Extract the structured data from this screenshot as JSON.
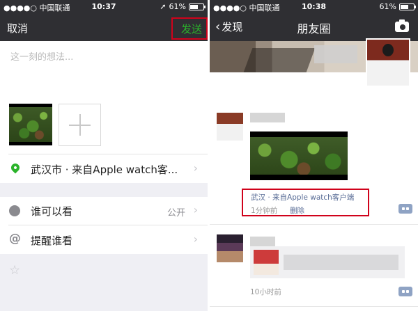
{
  "left": {
    "status": {
      "carrier": "●●●●○ 中国联通",
      "time": "10:37",
      "battery": "61%",
      "battery_level": 0.61
    },
    "nav": {
      "cancel": "取消",
      "send": "发送"
    },
    "compose": {
      "placeholder": "这一刻的想法..."
    },
    "location": {
      "label": "武汉市 · 来自Apple watch客..."
    },
    "visibility": {
      "label": "谁可以看",
      "value": "公开"
    },
    "mention": {
      "label": "提醒谁看"
    }
  },
  "right": {
    "status": {
      "carrier": "●●●●○ 中国联通",
      "time": "10:38",
      "battery": "61%",
      "battery_level": 0.61
    },
    "nav": {
      "back": "发现",
      "title": "朋友圈"
    },
    "post1": {
      "location": "武汉 · 来自Apple watch客户端",
      "time": "1分钟前",
      "delete": "删除"
    },
    "post2": {
      "time": "10小时前"
    }
  },
  "colors": {
    "nav_bg": "#2f2f33",
    "send_green": "#2bb32b",
    "highlight_red": "#d0021b",
    "link_blue": "#576b95"
  }
}
